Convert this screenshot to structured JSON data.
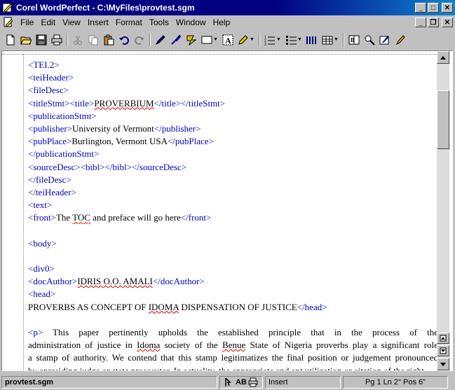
{
  "window": {
    "title": "Corel WordPerfect - C:\\MyFiles\\provtest.sgm",
    "minimize_symbol": "_",
    "maximize_symbol": "□",
    "close_symbol": "✕",
    "doc_minimize_symbol": "_",
    "doc_restore_symbol": "❐",
    "doc_close_symbol": "✕"
  },
  "menu": {
    "items": [
      "File",
      "Edit",
      "View",
      "Insert",
      "Format",
      "Tools",
      "Window",
      "Help"
    ]
  },
  "toolbar": {
    "icons": [
      "new-document-icon",
      "open-folder-icon",
      "save-icon",
      "print-icon",
      "cut-icon",
      "copy-icon",
      "paste-icon",
      "undo-icon",
      "redo-icon",
      "highlight-pen-icon",
      "quickformat-icon",
      "shapes-icon",
      "border-box-icon",
      "text-box-icon",
      "pencil-icon",
      "numbered-list-icon",
      "bulleted-list-icon",
      "columns-icon",
      "table-icon",
      "spellcheck-icon",
      "zoom-icon",
      "drawing-icon",
      "marker-icon"
    ]
  },
  "document": {
    "lines": [
      [
        {
          "t": "<TEI.2>",
          "tag": true
        }
      ],
      [
        {
          "t": "<teiHeader>",
          "tag": true
        }
      ],
      [
        {
          "t": "<fileDesc>",
          "tag": true
        }
      ],
      [
        {
          "t": "<titleStmt><title>",
          "tag": true
        },
        {
          "t": "PROVERBIUM",
          "sq": true
        },
        {
          "t": "</title></titleStmt>",
          "tag": true
        }
      ],
      [
        {
          "t": "<publicationStmt>",
          "tag": true
        }
      ],
      [
        {
          "t": "<publisher>",
          "tag": true
        },
        {
          "t": "University of Vermont"
        },
        {
          "t": "</publisher>",
          "tag": true
        }
      ],
      [
        {
          "t": "<pubPlace>",
          "tag": true
        },
        {
          "t": "Burlington, Vermont USA"
        },
        {
          "t": "</pubPlace>",
          "tag": true
        }
      ],
      [
        {
          "t": "</publicationStmt>",
          "tag": true
        }
      ],
      [
        {
          "t": "<sourceDesc><bibl></bibl></sourceDesc>",
          "tag": true
        }
      ],
      [
        {
          "t": "</fileDesc>",
          "tag": true
        }
      ],
      [
        {
          "t": "</teiHeader>",
          "tag": true
        }
      ],
      [
        {
          "t": "<text>",
          "tag": true
        }
      ],
      [
        {
          "t": "<front>",
          "tag": true
        },
        {
          "t": "The "
        },
        {
          "t": "TOC",
          "sq": true
        },
        {
          "t": " and preface will go here"
        },
        {
          "t": "</front>",
          "tag": true
        }
      ],
      [],
      [
        {
          "t": "<body>",
          "tag": true
        }
      ],
      [],
      [
        {
          "t": "<div0>",
          "tag": true
        }
      ],
      [
        {
          "t": "<docAuthor>",
          "tag": true
        },
        {
          "t": "IDRIS O.O. AMALI",
          "sq": true
        },
        {
          "t": "</docAuthor>",
          "tag": true
        }
      ],
      [
        {
          "t": "<head>",
          "tag": true
        }
      ],
      [
        {
          "t": "PROVERBS AS CONCEPT OF "
        },
        {
          "t": "IDOMA",
          "sq": true
        },
        {
          "t": " DISPENSATION OF JUSTICE"
        },
        {
          "t": "</head>",
          "tag": true
        }
      ],
      [],
      [
        {
          "t": "<p>",
          "tag": true
        },
        {
          "t": "                  This  paper  pertinently  upholds  the  established  principle  that  in  the  process  of  the"
        }
      ],
      [
        {
          "t": "administration of justice in "
        },
        {
          "t": "Idoma",
          "sq": true
        },
        {
          "t": " society of the "
        },
        {
          "t": "Benue",
          "sq": true
        },
        {
          "t": " State of Nigeria proverbs play a significant role"
        }
      ],
      [
        {
          "t": "a stamp of authority. We contend that this stamp legitimatizes the final position or judgement pronounced"
        }
      ],
      [
        {
          "t": "by "
        },
        {
          "t": "apresiding",
          "sq": true
        },
        {
          "t": " judge or state prosecutor. In actuality, the appropriate and apt utilization or citation of the right"
        }
      ]
    ]
  },
  "statusbar": {
    "filename": "provtest.sgm",
    "indicator_text": "AB",
    "mode": "Insert",
    "position": "Pg 1 Ln 2\" Pos 6\""
  }
}
